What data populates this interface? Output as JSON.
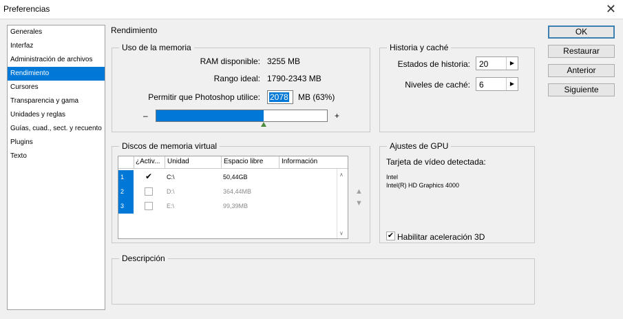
{
  "window": {
    "title": "Preferencias",
    "close_glyph": "✕"
  },
  "nav": {
    "items": [
      {
        "label": "Generales",
        "active": false
      },
      {
        "label": "Interfaz",
        "active": false
      },
      {
        "label": "Administración de archivos",
        "active": false
      },
      {
        "label": "Rendimiento",
        "active": true
      },
      {
        "label": "Cursores",
        "active": false
      },
      {
        "label": "Transparencia y gama",
        "active": false
      },
      {
        "label": "Unidades y reglas",
        "active": false
      },
      {
        "label": "Guías, cuad., sect. y recuento",
        "active": false
      },
      {
        "label": "Plugins",
        "active": false
      },
      {
        "label": "Texto",
        "active": false
      }
    ]
  },
  "section_title": "Rendimiento",
  "memory": {
    "legend": "Uso de la memoria",
    "ram_label": "RAM disponible:",
    "ram_value": "3255 MB",
    "range_label": "Rango ideal:",
    "range_value": "1790-2343 MB",
    "allow_label": "Permitir que Photoshop utilice:",
    "allow_value": "2078",
    "allow_suffix": "MB (63%)",
    "minus": "–",
    "plus": "+",
    "slider_percent": 63
  },
  "history": {
    "legend": "Historia y caché",
    "states_label": "Estados de historia:",
    "states_value": "20",
    "levels_label": "Niveles de caché:",
    "levels_value": "6"
  },
  "scratch": {
    "legend": "Discos de memoria virtual",
    "columns": [
      "¿Activ...",
      "Unidad",
      "Espacio libre",
      "Información"
    ],
    "rows": [
      {
        "num": "1",
        "active": true,
        "drive": "C:\\",
        "free": "50,44GB",
        "info": ""
      },
      {
        "num": "2",
        "active": false,
        "drive": "D:\\",
        "free": "364,44MB",
        "info": ""
      },
      {
        "num": "3",
        "active": false,
        "drive": "E:\\",
        "free": "99,39MB",
        "info": ""
      }
    ]
  },
  "gpu": {
    "legend": "Ajustes de GPU",
    "detected_label": "Tarjeta de vídeo detectada:",
    "vendor": "Intel",
    "model": "Intel(R) HD Graphics 4000",
    "accel_label": "Habilitar aceleración 3D",
    "accel_checked": true
  },
  "description": {
    "legend": "Descripción"
  },
  "buttons": {
    "ok": "OK",
    "reset": "Restaurar",
    "prev": "Anterior",
    "next": "Siguiente"
  },
  "colors": {
    "accent": "#0078d7",
    "slider_thumb": "#4d8a3d"
  }
}
